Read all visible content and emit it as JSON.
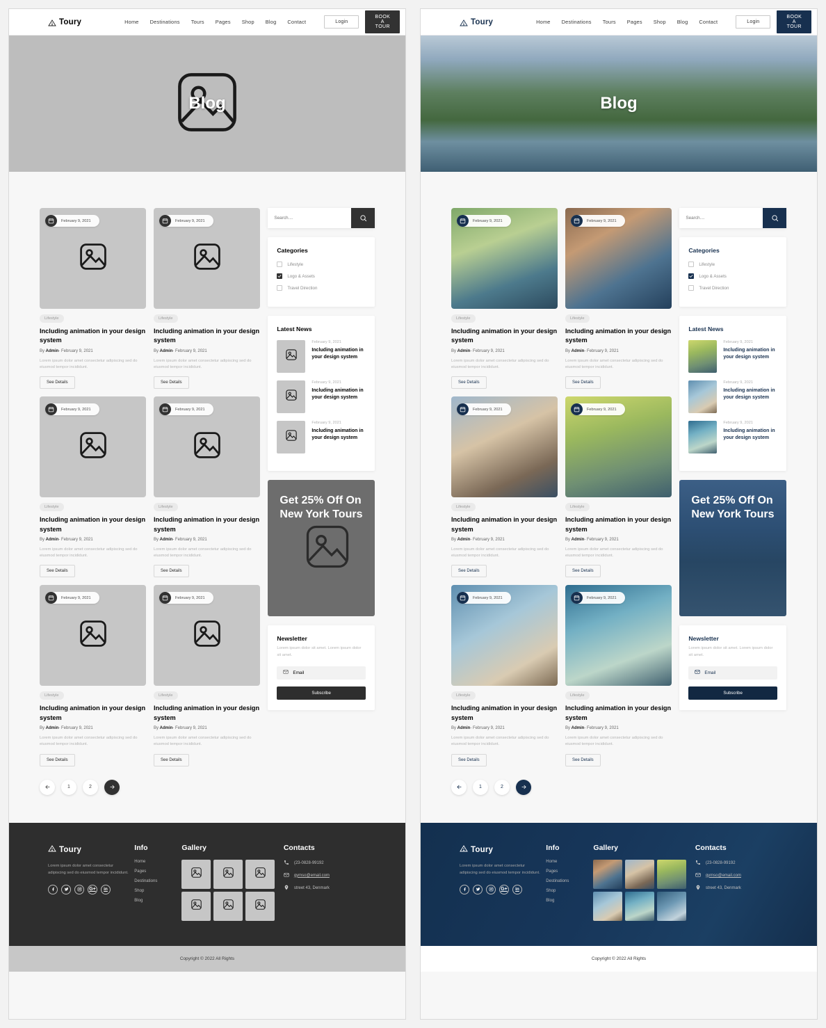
{
  "header": {
    "brand": "Toury",
    "nav": [
      "Home",
      "Destinations",
      "Tours",
      "Pages",
      "Shop",
      "Blog",
      "Contact"
    ],
    "login_label": "Login",
    "book_label": "BOOK A TOUR"
  },
  "hero": {
    "title": "Blog"
  },
  "posts": [
    {
      "date": "February 9, 2021",
      "tag": "Lifestyle",
      "title": "Including animation in your design system",
      "by_prefix": "By ",
      "author": "Admin",
      "meta_date": "- February 9, 2021",
      "desc": "Lorem ipsum dolor amet consectetur adipiscing sed do eiusmod tempor incididunt.",
      "cta": "See Details"
    },
    {
      "date": "February 9, 2021",
      "tag": "Lifestyle",
      "title": "Including animation in your design system",
      "by_prefix": "By ",
      "author": "Admin",
      "meta_date": "- February 9, 2021",
      "desc": "Lorem ipsum dolor amet consectetur adipiscing sed do eiusmod tempor incididunt.",
      "cta": "See Details"
    },
    {
      "date": "February 9, 2021",
      "tag": "Lifestyle",
      "title": "Including animation in your design system",
      "by_prefix": "By ",
      "author": "Admin",
      "meta_date": "- February 9, 2021",
      "desc": "Lorem ipsum dolor amet consectetur adipiscing sed do eiusmod tempor incididunt.",
      "cta": "See Details"
    },
    {
      "date": "February 9, 2021",
      "tag": "Lifestyle",
      "title": "Including animation in your design system",
      "by_prefix": "By ",
      "author": "Admin",
      "meta_date": "- February 9, 2021",
      "desc": "Lorem ipsum dolor amet consectetur adipiscing sed do eiusmod tempor incididunt.",
      "cta": "See Details"
    },
    {
      "date": "February 9, 2021",
      "tag": "Lifestyle",
      "title": "Including animation in your design system",
      "by_prefix": "By ",
      "author": "Admin",
      "meta_date": "- February 9, 2021",
      "desc": "Lorem ipsum dolor amet consectetur adipiscing sed do eiusmod tempor incididunt.",
      "cta": "See Details"
    },
    {
      "date": "February 9, 2021",
      "tag": "Lifestyle",
      "title": "Including animation in your design system",
      "by_prefix": "By ",
      "author": "Admin",
      "meta_date": "- February 9, 2021",
      "desc": "Lorem ipsum dolor amet consectetur adipiscing sed do eiusmod tempor incididunt.",
      "cta": "See Details"
    }
  ],
  "pagination": {
    "prev": "prev-arrow-icon",
    "pages": [
      "1",
      "2"
    ],
    "next": "next-arrow-icon"
  },
  "sidebar": {
    "search_placeholder": "Search....",
    "categories_title": "Categories",
    "categories": [
      {
        "label": "Lifestyle",
        "checked": false
      },
      {
        "label": "Logo & Assets",
        "checked": true
      },
      {
        "label": "Travel Direction",
        "checked": false
      }
    ],
    "latest_title": "Latest News",
    "latest": [
      {
        "date": "February 9, 2021",
        "title": "Including animation in your design system"
      },
      {
        "date": "February 9, 2021",
        "title": "Including animation in your design system"
      },
      {
        "date": "February 9, 2021",
        "title": "Including animation in your design system"
      }
    ],
    "promo_text": "Get 25% Off On New York Tours",
    "newsletter_title": "Newsletter",
    "newsletter_desc": "Lorem ipsum dolor sit amet. Lorem ipsum dolor sit amet.",
    "newsletter_placeholder": "Email",
    "subscribe_label": "Subscribe"
  },
  "footer": {
    "brand": "Toury",
    "desc": "Lorem ipsum dolor amet consectetur adipiscing sed do eiusmod tempor incididunt.",
    "socials": [
      "facebook-icon",
      "twitter-icon",
      "instagram-icon",
      "google-plus-icon",
      "linkedin-icon"
    ],
    "info_title": "Info",
    "info_links": [
      "Home",
      "Pages",
      "Destinations",
      "Shop",
      "Blog"
    ],
    "gallery_title": "Gallery",
    "gallery_count": 6,
    "contacts_title": "Contacts",
    "phone": "(23-0828-99192",
    "email": "gymso@email.com",
    "address": "street 43, Denmark",
    "copyright": "Copyright © 2022 All Rights"
  },
  "theme": {
    "left_accent": "#323232",
    "left_accent_dark": "#2e2e2e",
    "left_placeholder": "#bdbdbd",
    "right_accent": "#17304f",
    "right_accent_dark": "#122842",
    "panel_bg": "#f7f7f7"
  }
}
